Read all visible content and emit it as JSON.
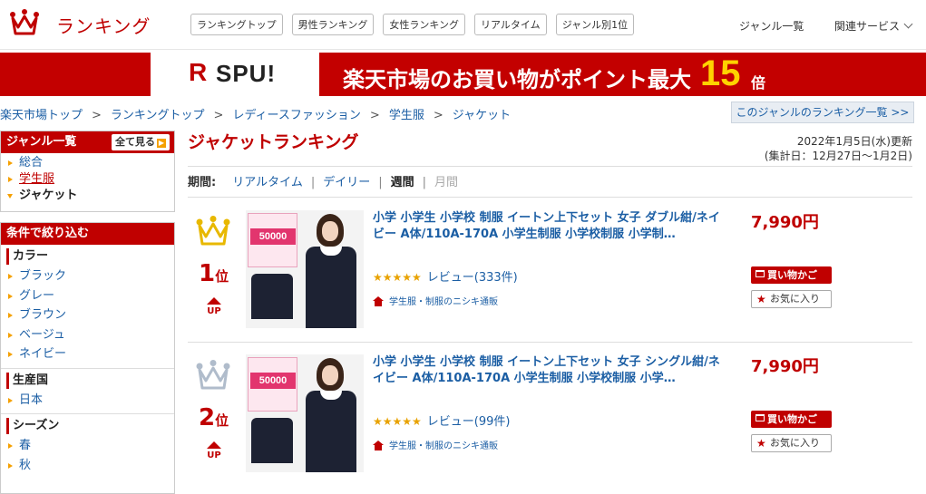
{
  "header": {
    "brand": "ランキング",
    "tabs": [
      "ランキングトップ",
      "男性ランキング",
      "女性ランキング",
      "リアルタイム",
      "ジャンル別1位"
    ],
    "genre_list": "ジャンル一覧",
    "related": "関連サービス"
  },
  "banner": {
    "spu_r": "R",
    "spu": "SPU!",
    "text": "楽天市場のお買い物がポイント最大",
    "number": "15",
    "suffix": "倍"
  },
  "breadcrumb": [
    "楽天市場トップ",
    "ランキングトップ",
    "レディースファッション",
    "学生服",
    "ジャケット"
  ],
  "genre_rank_link": "このジャンルのランキング一覧 >>",
  "sidebar": {
    "genre_title": "ジャンル一覧",
    "all_button": "全て見る",
    "genres": [
      "総合",
      "学生服",
      "ジャケット"
    ],
    "filter_title": "条件で絞り込む",
    "color_title": "カラー",
    "colors": [
      "ブラック",
      "グレー",
      "ブラウン",
      "ベージュ",
      "ネイビー"
    ],
    "origin_title": "生産国",
    "origins": [
      "日本"
    ],
    "season_title": "シーズン",
    "seasons": [
      "春",
      "秋"
    ]
  },
  "main": {
    "title": "ジャケットランキング",
    "updated": "2022年1月5日(水)更新",
    "period_range": "(集計日：12月27日〜1月2日)",
    "period_label": "期間:",
    "periods": [
      "リアルタイム",
      "デイリー",
      "週間",
      "月間"
    ]
  },
  "items": [
    {
      "rank": "1",
      "rank_suffix": "位",
      "trend": "UP",
      "badge": "50000",
      "title": "小学 小学生 小学校 制服 イートン上下セット 女子 ダブル紺/ネイビー A体/110A-170A 小学生制服 小学校制服 小学制…",
      "stars": "★★★★★",
      "review": "レビュー(333件)",
      "shop": "学生服・制服のニシキ通販",
      "price": "7,990円",
      "cart": "買い物かご",
      "fav": "お気に入り"
    },
    {
      "rank": "2",
      "rank_suffix": "位",
      "trend": "UP",
      "badge": "50000",
      "title": "小学 小学生 小学校 制服 イートン上下セット 女子 シングル紺/ネイビー A体/110A-170A 小学生制服 小学校制服 小学…",
      "stars": "★★★★★",
      "review": "レビュー(99件)",
      "shop": "学生服・制服のニシキ通販",
      "price": "7,990円",
      "cart": "買い物かご",
      "fav": "お気に入り"
    }
  ],
  "colors": {
    "accent": "#bf0000",
    "link": "#1b5ea4",
    "gold": "#e8a200",
    "silver": "#b0bccb"
  }
}
